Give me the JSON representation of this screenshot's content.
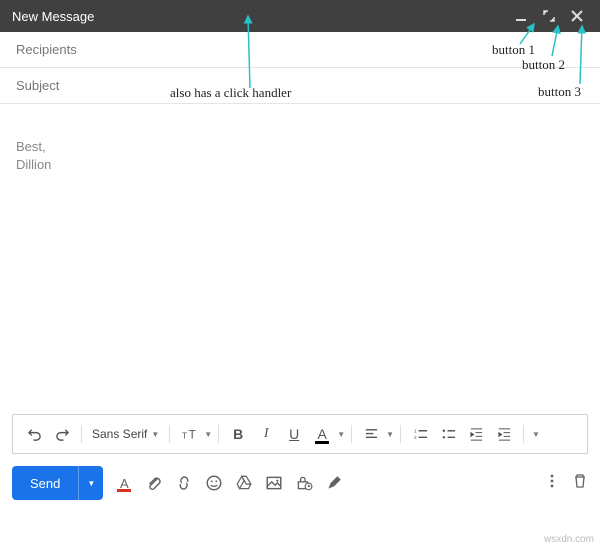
{
  "header": {
    "title": "New Message",
    "minimize_name": "minimize-icon",
    "expand_name": "expand-icon",
    "close_name": "close-icon"
  },
  "fields": {
    "recipients_placeholder": "Recipients",
    "subject_placeholder": "Subject"
  },
  "body": {
    "line1": "Best,",
    "line2": "Dillion"
  },
  "toolbar": {
    "font_family": "Sans Serif"
  },
  "send": {
    "label": "Send"
  },
  "annotations": {
    "click_handler": "also has a click handler",
    "button1": "button 1",
    "button2": "button 2",
    "button3": "button 3"
  },
  "watermark": "wsxdn.com",
  "colors": {
    "header_bg": "#404040",
    "primary": "#1a73e8",
    "arrow": "#29c0c7"
  }
}
